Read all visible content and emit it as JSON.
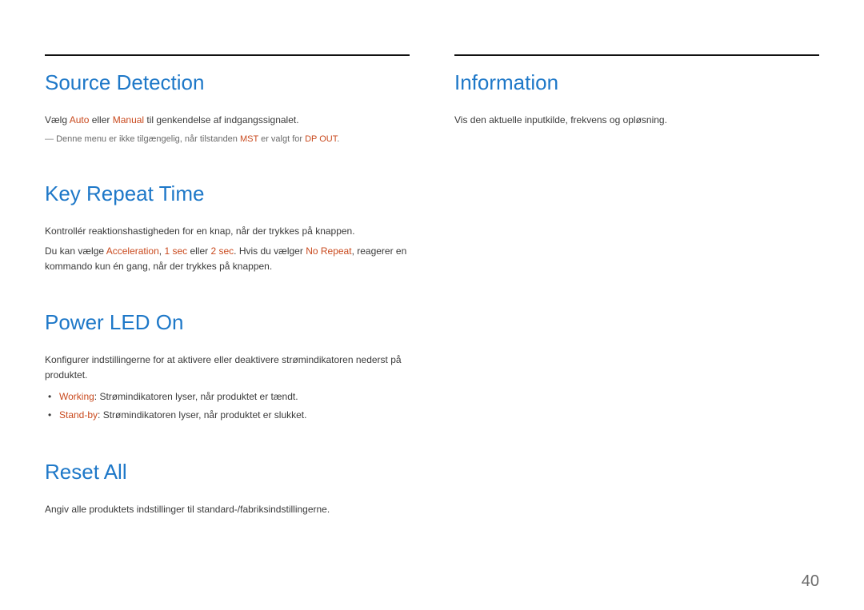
{
  "page_number": "40",
  "left": {
    "source_detection": {
      "title": "Source Detection",
      "line1_pre": "Vælg ",
      "line1_hl1": "Auto",
      "line1_mid": " eller ",
      "line1_hl2": "Manual",
      "line1_post": " til genkendelse af indgangssignalet.",
      "note_pre": "Denne menu er ikke tilgængelig, når tilstanden ",
      "note_hl1": "MST",
      "note_mid": " er valgt for ",
      "note_hl2": "DP OUT",
      "note_post": "."
    },
    "key_repeat": {
      "title": "Key Repeat Time",
      "line1": "Kontrollér reaktionshastigheden for en knap, når der trykkes på knappen.",
      "line2_pre": "Du kan vælge ",
      "line2_hl1": "Acceleration",
      "line2_mid1": ", ",
      "line2_hl2": "1 sec",
      "line2_mid2": " eller ",
      "line2_hl3": "2 sec",
      "line2_mid3": ". Hvis du vælger ",
      "line2_hl4": "No Repeat",
      "line2_post": ", reagerer en kommando kun én gang, når der trykkes på knappen."
    },
    "power_led": {
      "title": "Power LED On",
      "line1": "Konfigurer indstillingerne for at aktivere eller deaktivere strømindikatoren nederst på produktet.",
      "bullet1_hl": "Working",
      "bullet1_post": ": Strømindikatoren lyser, når produktet er tændt.",
      "bullet2_hl": "Stand-by",
      "bullet2_post": ": Strømindikatoren lyser, når produktet er slukket."
    },
    "reset_all": {
      "title": "Reset All",
      "line1": "Angiv alle produktets indstillinger til standard-/fabriksindstillingerne."
    }
  },
  "right": {
    "information": {
      "title": "Information",
      "line1": "Vis den aktuelle inputkilde, frekvens og opløsning."
    }
  }
}
